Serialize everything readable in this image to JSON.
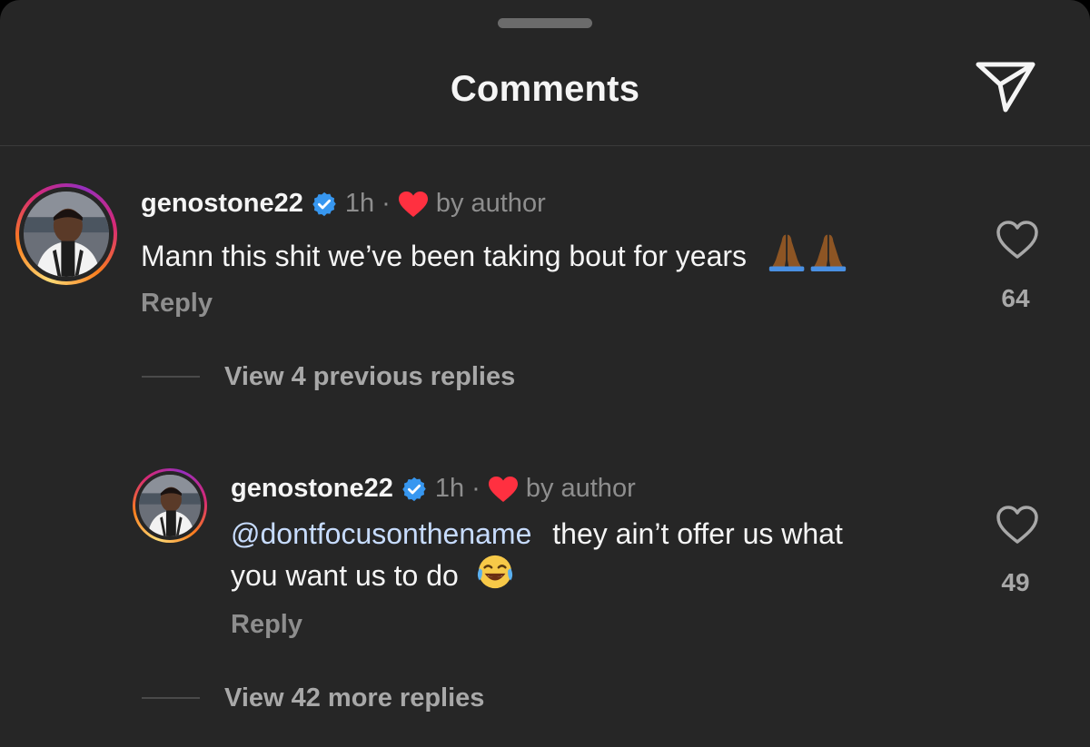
{
  "header": {
    "title": "Comments",
    "share_icon": "paper-plane-icon"
  },
  "comments": [
    {
      "username": "genostone22",
      "verified": true,
      "time": "1h",
      "separator": "·",
      "liked_by_author_label": "by author",
      "text": "Mann this shit we’ve been taking bout for years",
      "emoji": "folded-hands-medium-dark x2",
      "reply_label": "Reply",
      "like_count": "64",
      "view_replies_label": "View 4 previous replies"
    },
    {
      "username": "genostone22",
      "verified": true,
      "time": "1h",
      "separator": "·",
      "liked_by_author_label": "by author",
      "mention": "@dontfocusonthename",
      "text_line1": "they ain’t offer us what",
      "text_line2": "you want us to do",
      "emoji": "face-with-tears-of-joy",
      "reply_label": "Reply",
      "like_count": "49",
      "view_replies_label": "View 42 more replies"
    }
  ],
  "colors": {
    "background": "#262626",
    "text_primary": "#f5f5f5",
    "text_secondary": "#8e8e8e",
    "mention": "#c7dcff",
    "verified_blue": "#3797f0",
    "heart_red": "#ff3040"
  }
}
